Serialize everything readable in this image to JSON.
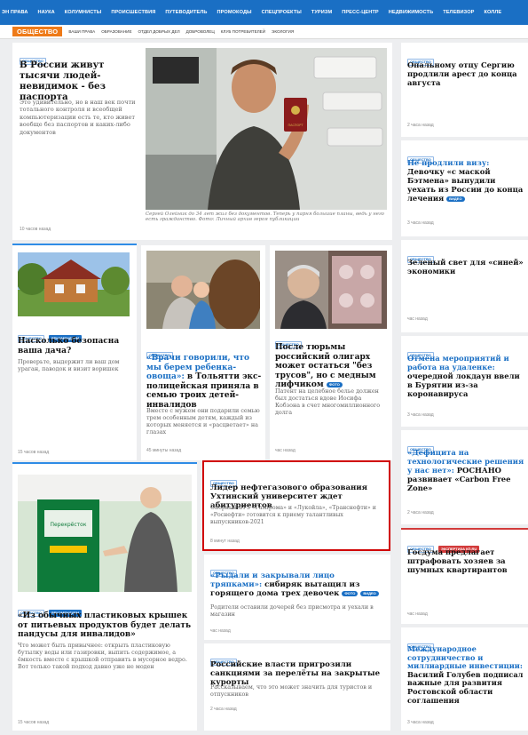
{
  "topnav": [
    "ЭН ПРАВА",
    "НАУКА",
    "КОЛУМНИСТЫ",
    "ПРОИСШЕСТВИЯ",
    "ПУТЕВОДИТЕЛЬ",
    "ПРОМОКОДЫ",
    "СПЕЦПРОЕКТЫ",
    "ТУРИЗМ",
    "ПРЕСС-ЦЕНТР",
    "НЕДВИЖИМОСТЬ",
    "ТЕЛЕВИЗОР",
    "КОЛЛЕ"
  ],
  "subnav": {
    "section": "ОБЩЕСТВО",
    "items": [
      "ВАШИ ПРАВА",
      "ОБРАЗОВАНИЕ",
      "ОТДЕЛ ДОБРЫХ ДЕЛ",
      "ДОБРОВОЛЕЦ",
      "КЛУБ ПОТРЕБИТЕЛЕЙ",
      "ЭКОЛОГИЯ"
    ]
  },
  "main": {
    "tag": "ОБЩЕСТВО",
    "title": "В России живут тысячи людей-невидимок - без паспорта",
    "lead": "Это удивительно, но в наш век почти тотального контроля и всеобщей компьютеризации есть те, кто живет вообще без паспортов и каких-либо документов",
    "time": "10 часов назад",
    "caption": "Сергей Олейник до 34 лет жил без документов. Теперь у парня большие планы, ведь у него есть гражданство. Фото: Личный архив героя публикации"
  },
  "row2": [
    {
      "tags": [
        "ОБЩЕСТВО",
        "РЕКОМЕНДУЕМ"
      ],
      "title": "Насколько безопасна ваша дача?",
      "lead": "Проверьте, выдержит ли ваш дом ураган, паводок и визит воришек",
      "time": "15 часов назад"
    },
    {
      "tags": [
        "ОБЩЕСТВО"
      ],
      "title_blue": "«Врачи говорили, что мы берем ребенка-овоща»:",
      "title": "в Тольятти экс-полицейская приняла в семью троих детей-инвалидов",
      "lead": "Вместе с мужем они подарили семью трем особенным детям, каждый из которых меняется и «расцветает» на глазах",
      "time": "45 минуты назад"
    },
    {
      "tags": [
        "ОБЩЕСТВО"
      ],
      "title": "После тюрьмы российский олигарх может остаться \"без трусов\", но с медным лифчиком",
      "pill": "ФОТО",
      "lead": "Патент на целебное белье должен был достаться вдове Иосифа Кобзона в счет многомиллионного долга",
      "time": "час назад"
    }
  ],
  "row3_left": {
    "tags": [
      "ОБЩЕСТВО",
      "РЕКОМЕНДУЕМ"
    ],
    "title": "«Из обычных пластиковых крышек от питьевых продуктов будет делать пандусы для инвалидов»",
    "lead": "Что может быть привычнее: открыть пластиковую бутылку воды или газировки, выпить содержимое, а ёмкость вместе с крышкой отправить в мусорное ведро. Вот только такой подход давно уже не моден",
    "time": "15 часов назад"
  },
  "highlight": {
    "tag": "ОБЩЕСТВО",
    "title": "Лидер нефтегазового образования Ухтинский университет ждет абитуриентов",
    "lead": "Опорный ВУЗ «Газпрома» и «Лукойла», «Транснефти» и «Роснефти» готовится к приему талантливых выпускников-2021",
    "time": "8 минут назад"
  },
  "mid2": {
    "tag": "ОБЩЕСТВО",
    "title_blue": "«Рыдали и закрывали лицо тряпками»:",
    "title": "сибиряк вытащил из горящего дома трех девочек",
    "pills": [
      "ФОТО",
      "ВИДЕО"
    ],
    "lead": "Родители оставили дочерей без присмотра и уехали в магазин",
    "time": "час назад"
  },
  "mid3": {
    "tag": "ОБЩЕСТВО",
    "title": "Российские власти пригрозили санкциями за перелёты на закрытые курорты",
    "lead": "Рассказываем, что это может значить для туристов и отпускников",
    "time": "2 часа назад"
  },
  "side": [
    {
      "tags": [
        "ОБЩЕСТВО"
      ],
      "title": "Опальному отцу Сергию продлили арест до конца августа",
      "time": "2 часа назад"
    },
    {
      "tags": [
        "ОБЩЕСТВО"
      ],
      "title_blue": "Не продлили визу:",
      "title": "Девочку «с маской Бэтмена» вынудили уехать из России до конца лечения",
      "pill": "ВИДЕО",
      "time": "3 часа назад"
    },
    {
      "tags": [
        "ОБЩЕСТВО"
      ],
      "title": "Зеленый свет для «синей» экономики",
      "time": "час назад"
    },
    {
      "tags": [
        "ОБЩЕСТВО"
      ],
      "title_blue": "Отмена мероприятий и работа на удаленке:",
      "title": "очередной локдаун ввели в Бурятии из-за коронавируса",
      "time": "3 часа назад"
    },
    {
      "tags": [
        "ОБЩЕСТВО"
      ],
      "title_blue": "«Дефицита на технологические решения у нас нет»:",
      "title": "РОСНАНО развивает «Carbon Free Zone»",
      "time": "2 часа назад"
    },
    {
      "tags": [
        "ОБЩЕСТВО",
        "ЭКСПЕРТИЗА КП.RU"
      ],
      "title": "Госдума предлагает штрафовать хозяев за шумных квартирантов",
      "time": "час назад"
    },
    {
      "tags": [
        "ОБЩЕСТВО"
      ],
      "title_blue": "Международное сотрудничество и миллиардные инвестиции:",
      "title": "Василий Голубев подписал важные для развития Ростовской области соглашения",
      "time": "3 часа назад"
    }
  ],
  "photo_texts": {
    "passport": "ПАСПОРТ",
    "store": "Перекрёсток"
  },
  "colors": {
    "nav": "#1a6fc4",
    "section": "#ee7a18",
    "highlight_border": "#d00000"
  }
}
